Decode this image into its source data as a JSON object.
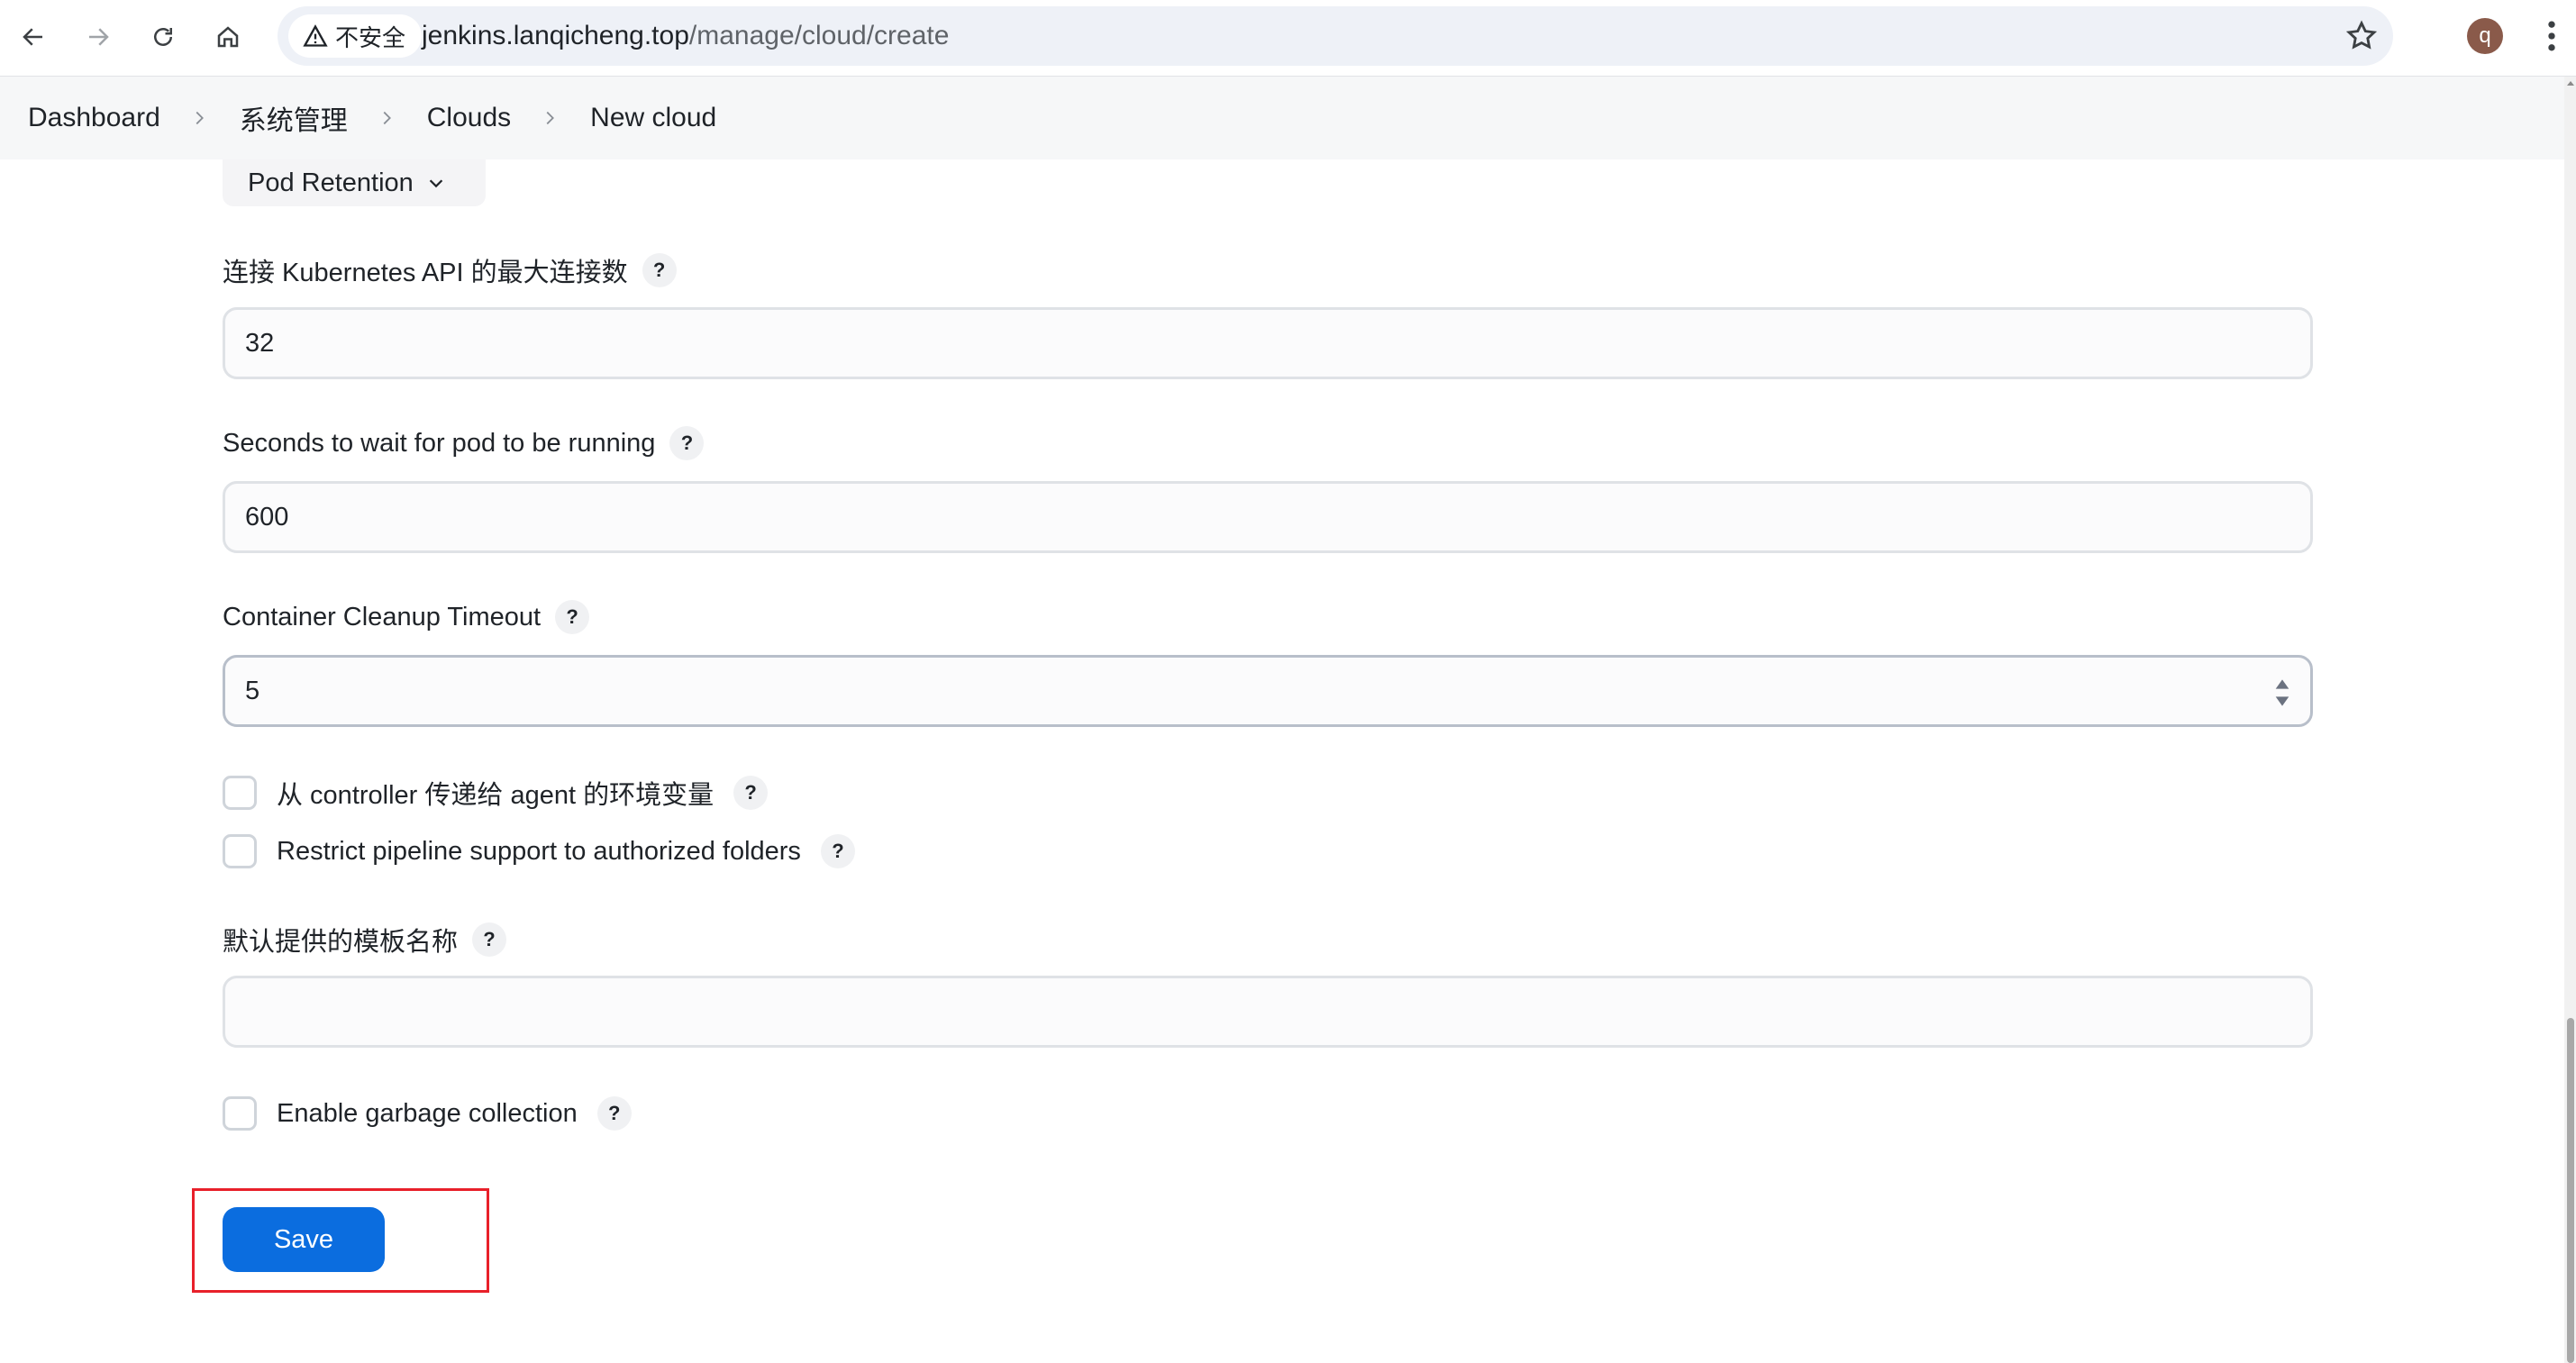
{
  "browser": {
    "security_label": "不安全",
    "url_host": "jenkins.lanqicheng.top",
    "url_path": "/manage/cloud/create",
    "avatar_letter": "q"
  },
  "breadcrumb": [
    "Dashboard",
    "系统管理",
    "Clouds",
    "New cloud"
  ],
  "form": {
    "pod_retention_label": "Pod Retention",
    "max_connections": {
      "label": "连接 Kubernetes API 的最大连接数",
      "value": "32"
    },
    "wait_seconds": {
      "label": "Seconds to wait for pod to be running",
      "value": "600"
    },
    "cleanup_timeout": {
      "label": "Container Cleanup Timeout",
      "value": "5"
    },
    "pass_env_label": "从 controller 传递给 agent 的环境变量",
    "restrict_pipeline_label": "Restrict pipeline support to authorized folders",
    "default_template": {
      "label": "默认提供的模板名称",
      "value": ""
    },
    "garbage_collection_label": "Enable garbage collection",
    "help_glyph": "?",
    "save_label": "Save"
  },
  "colors": {
    "primary_button": "#0b6ddf",
    "highlight_box": "#e8202a"
  }
}
